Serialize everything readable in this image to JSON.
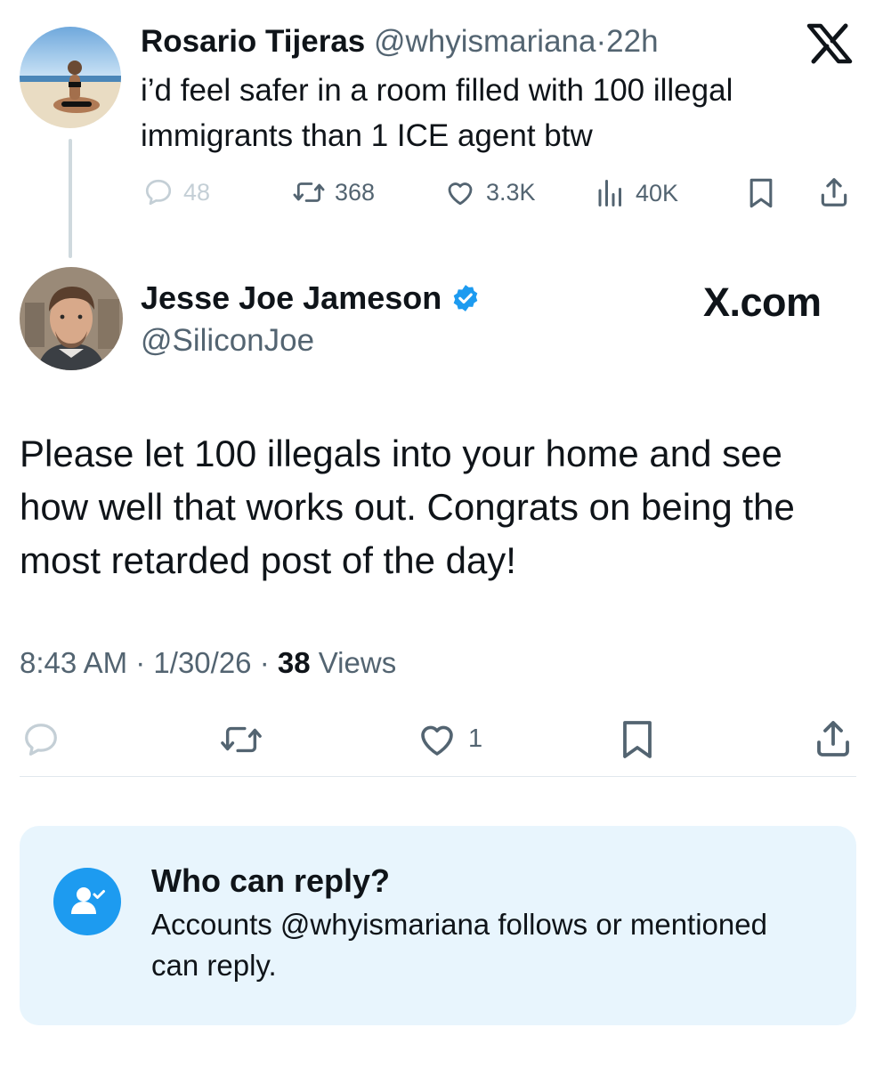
{
  "parent": {
    "name": "Rosario Tijeras",
    "handle": "@whyismariana",
    "separator": "·",
    "time": "22h",
    "text": "i’d feel safer in a room filled with 100 illegal immigrants than 1 ICE agent btw",
    "avatar_icon": "beach-photo-avatar",
    "stats": {
      "replies": "48",
      "reposts": "368",
      "likes": "3.3K",
      "views": "40K"
    }
  },
  "reply": {
    "name": "Jesse Joe Jameson",
    "handle": "@SiliconJoe",
    "verified": true,
    "avatar_icon": "man-photo-avatar",
    "brand": "X.com",
    "text": "Please let 100 illegals into your home and see how well that works out. Congrats on being the most retarded post of the day!",
    "time": "8:43 AM",
    "sep1": "·",
    "date": "1/30/26",
    "sep2": "·",
    "views_count": "38",
    "views_label": "Views",
    "stats": {
      "likes": "1"
    }
  },
  "who_can_reply": {
    "title": "Who can reply?",
    "description": "Accounts @whyismariana follows or mentioned can reply."
  },
  "colors": {
    "accent": "#1d9bf0",
    "secondary_text": "#536471",
    "info_box_bg": "#e8f5fd"
  }
}
